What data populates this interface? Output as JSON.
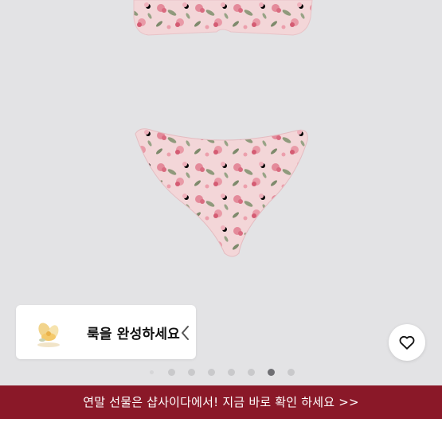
{
  "gallery": {
    "look_card": {
      "label": "룩을 완성하세요"
    },
    "pagination": {
      "count": 8,
      "active_index": 6
    }
  },
  "banner": {
    "text": "연말 선물은 샵사이다에서! 지금 바로 확인 하세요 >>"
  },
  "colors": {
    "banner": "#8a1828",
    "background": "#e3e3e5",
    "dot_active": "#6f6f73",
    "dot_inactive": "#c9c9cb"
  },
  "icons": {
    "wishlist": "heart-outline-icon",
    "look_collapse": "chevron-left-icon"
  }
}
